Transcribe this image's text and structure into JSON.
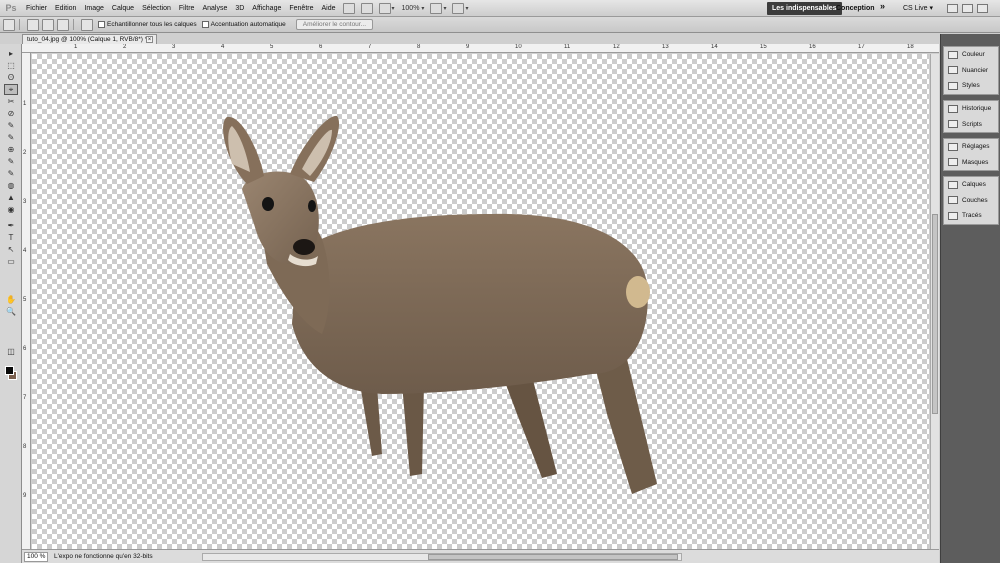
{
  "app": {
    "logo": "Ps"
  },
  "menu": {
    "items": [
      "Fichier",
      "Edition",
      "Image",
      "Calque",
      "Sélection",
      "Filtre",
      "Analyse",
      "3D",
      "Affichage",
      "Fenêtre",
      "Aide"
    ],
    "zoom": "100%"
  },
  "workspace": {
    "active": "Les indispensables",
    "other": "Conception",
    "more": "»",
    "cslive": "CS Live ▾"
  },
  "options": {
    "sample_all_layers": "Echantillonner tous les calques",
    "auto_enhance": "Accentuation automatique",
    "refine_edge": "Améliorer le contour..."
  },
  "document": {
    "tab_title": "tuto_04.jpg @ 100% (Calque 1, RVB/8*) *",
    "close": "×",
    "ruler_top": [
      "1",
      "2",
      "3",
      "4",
      "5",
      "6",
      "7",
      "8",
      "9",
      "10",
      "11",
      "12",
      "13",
      "14",
      "15",
      "16",
      "17",
      "18"
    ],
    "ruler_left": [
      "1",
      "2",
      "3",
      "4",
      "5",
      "6",
      "7",
      "8",
      "9"
    ],
    "status_zoom": "100 %",
    "status_text": "L'expo ne fonctionne qu'en 32-bits"
  },
  "panels": {
    "group1": [
      "Couleur",
      "Nuancier",
      "Styles"
    ],
    "group2": [
      "Historique",
      "Scripts"
    ],
    "group3": [
      "Réglages",
      "Masques"
    ],
    "group4": [
      "Calques",
      "Couches",
      "Tracés"
    ]
  },
  "tools": {
    "glyphs": [
      "▸",
      "⬚",
      "ʘ",
      "⌖",
      "✂",
      "⊘",
      "✎",
      "✎",
      "⊕",
      "✎",
      "✎",
      "◍",
      "▲",
      "◉",
      "✒",
      "T",
      "↖",
      "▭",
      "✋",
      "🔍"
    ]
  },
  "colors": {
    "foreground": "#0a0a0a",
    "background": "#7a5f4e",
    "workspace_active": "#3c3c3c"
  }
}
